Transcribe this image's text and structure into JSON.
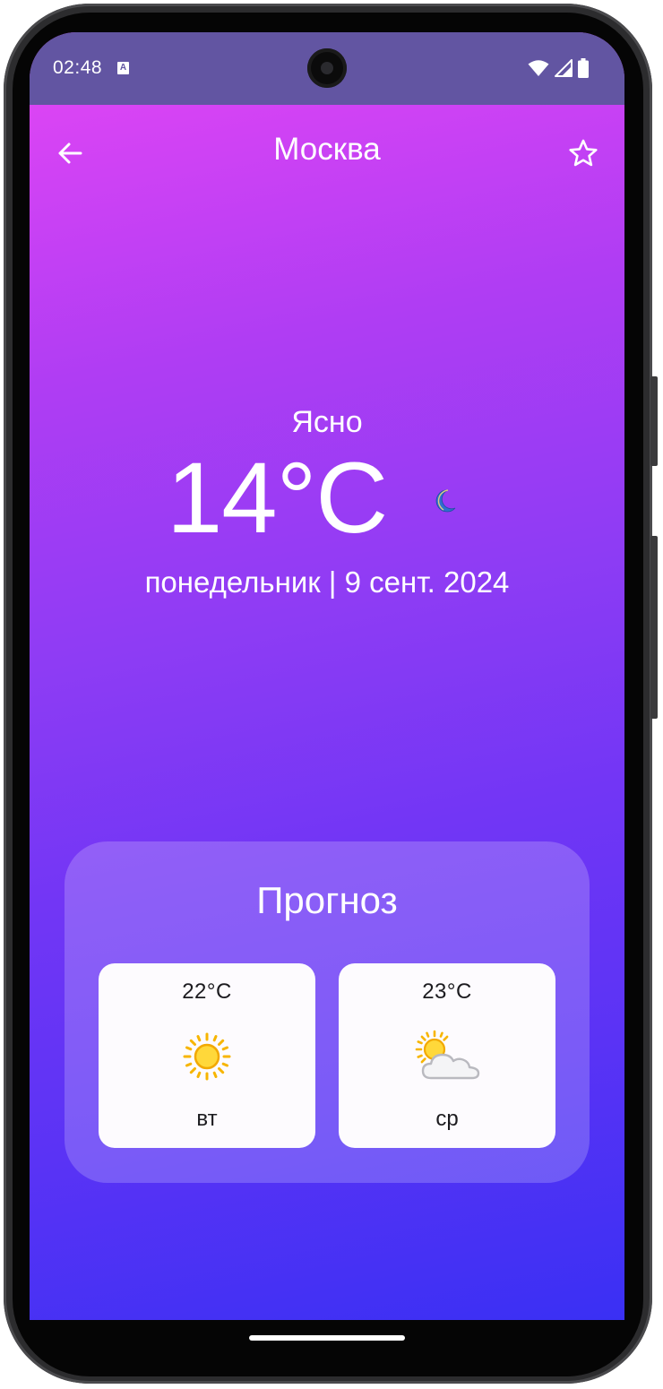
{
  "status_bar": {
    "time": "02:48",
    "notification_letter": "A",
    "icons": [
      "wifi-icon",
      "cell-signal-icon",
      "battery-icon"
    ]
  },
  "header": {
    "city": "Москва",
    "back_icon": "arrow-left-icon",
    "favorite_icon": "star-outline-icon"
  },
  "current": {
    "condition": "Ясно",
    "temperature": "14°C",
    "weather_icon": "crescent-moon-icon",
    "date": "понедельник | 9 сент. 2024"
  },
  "forecast": {
    "title": "Прогноз",
    "days": [
      {
        "temperature": "22°C",
        "day": "вт",
        "icon": "sun-icon"
      },
      {
        "temperature": "23°C",
        "day": "ср",
        "icon": "sun-behind-cloud-icon"
      }
    ]
  },
  "colors": {
    "status_bar": "#6255a2",
    "gradient_top": "#e646f5",
    "gradient_bottom": "#3a30f4",
    "card_background": "#fdfbfe",
    "moon": "#2f6fd0",
    "sun": "#f7b500"
  }
}
